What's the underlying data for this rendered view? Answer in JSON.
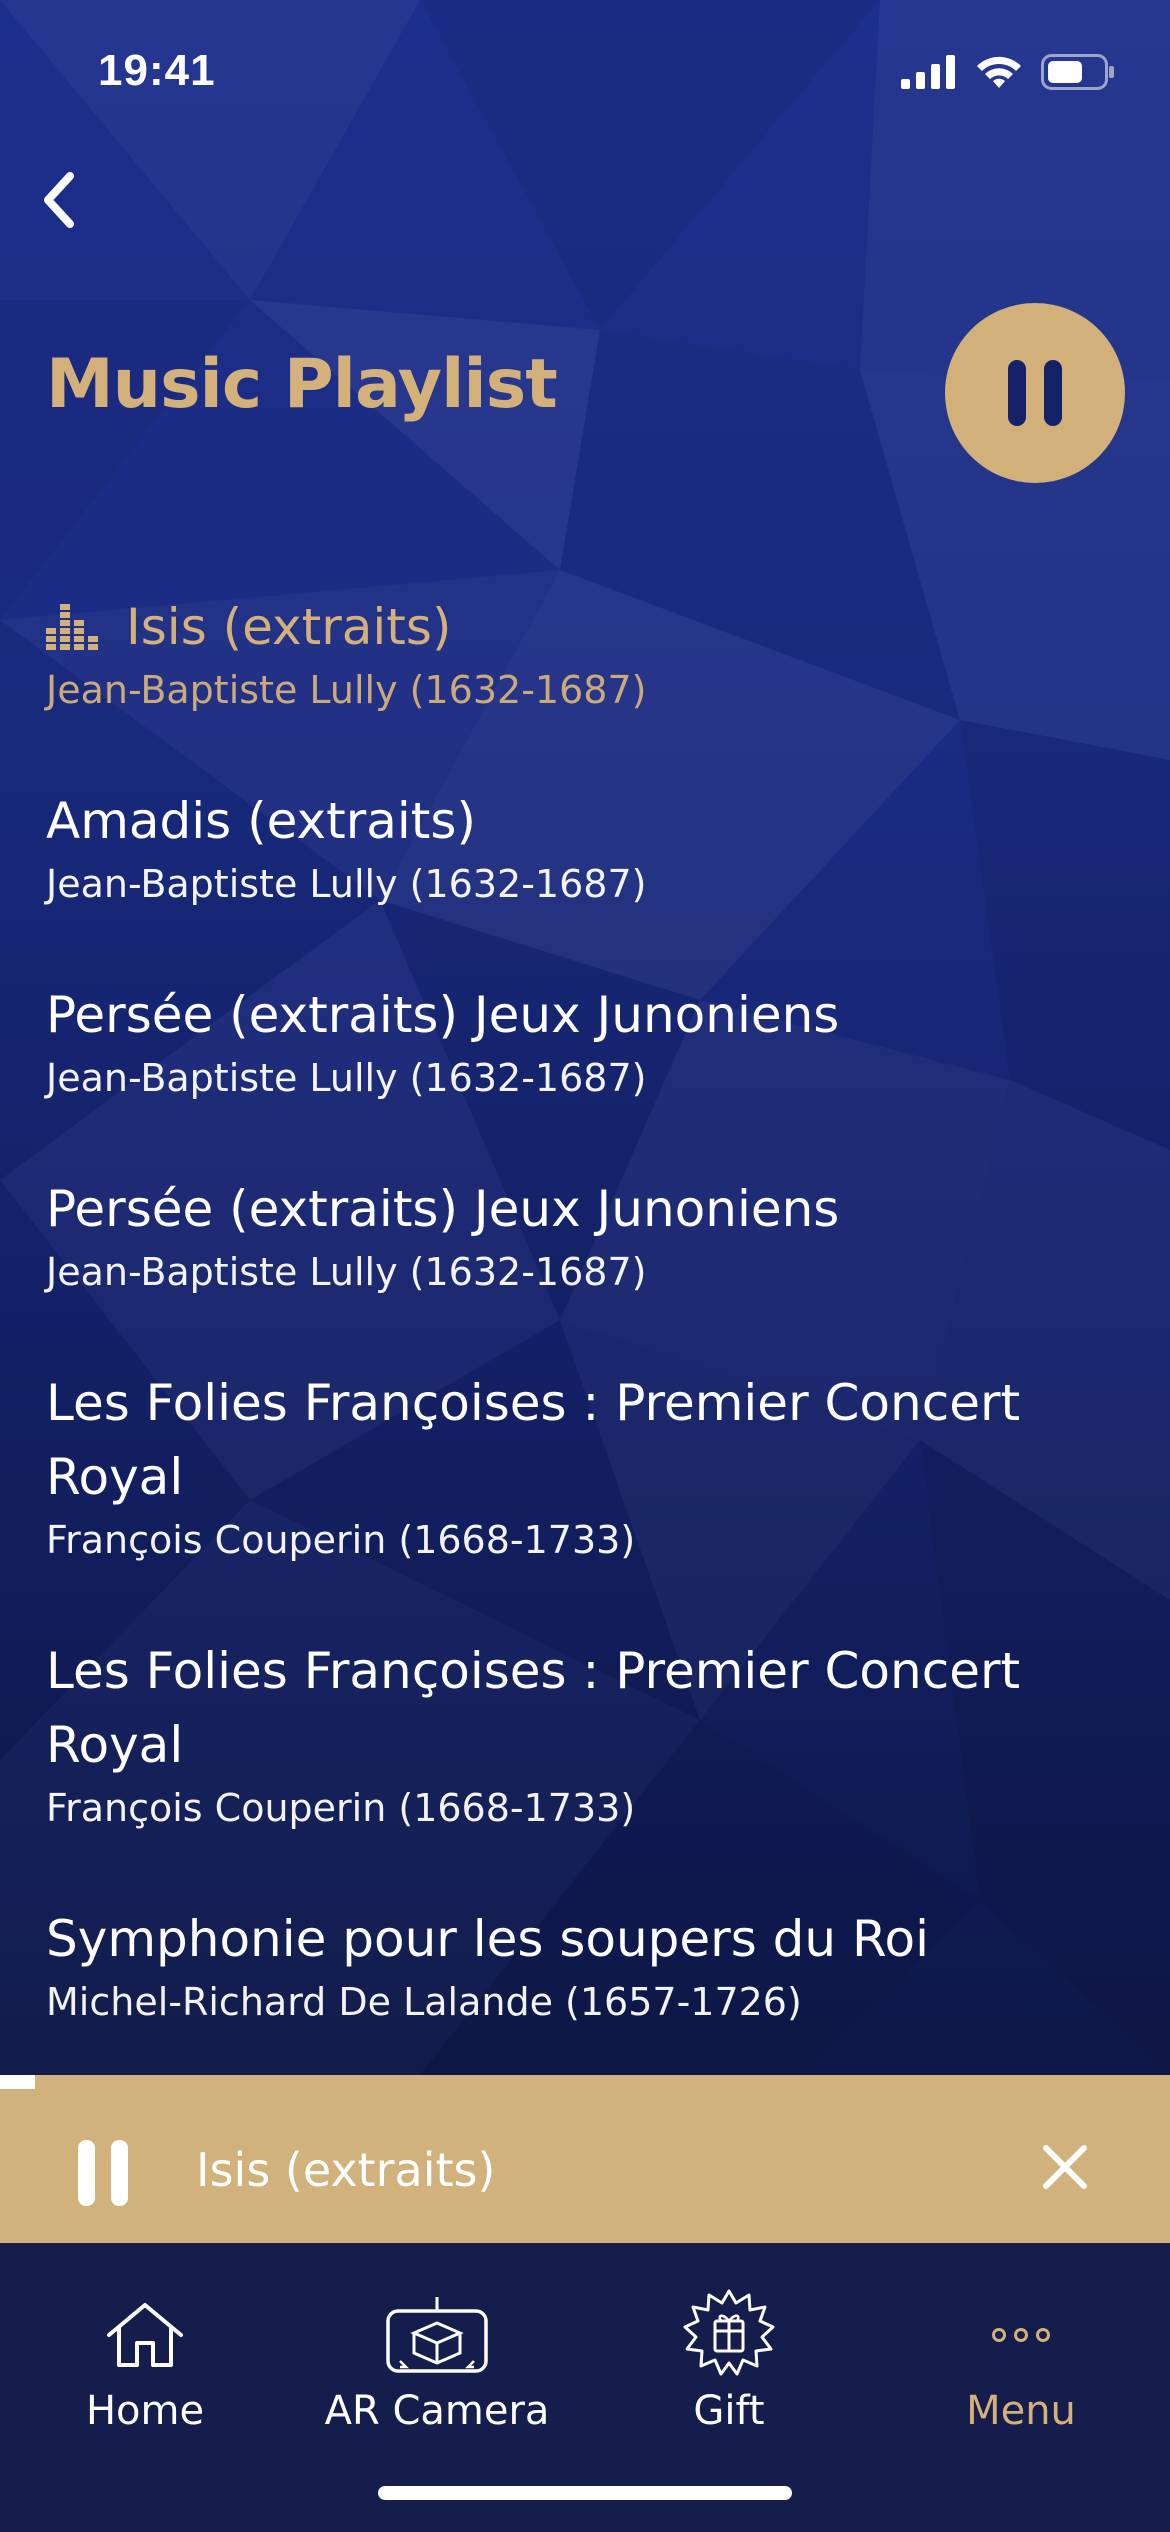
{
  "status_bar": {
    "time": "19:41"
  },
  "header": {
    "title": "Music Playlist"
  },
  "playlist": [
    {
      "title": "Isis (extraits)",
      "artist": "Jean-Baptiste Lully (1632-1687)",
      "active": true
    },
    {
      "title": "Amadis (extraits)",
      "artist": "Jean-Baptiste Lully (1632-1687)",
      "active": false
    },
    {
      "title": "Persée (extraits) Jeux Junoniens",
      "artist": "Jean-Baptiste Lully (1632-1687)",
      "active": false
    },
    {
      "title": "Persée (extraits) Jeux Junoniens",
      "artist": "Jean-Baptiste Lully (1632-1687)",
      "active": false
    },
    {
      "title": "Les Folies Françoises : Premier Concert Royal",
      "artist": "François Couperin (1668-1733)",
      "active": false
    },
    {
      "title": "Les Folies Françoises : Premier Concert Royal",
      "artist": "François Couperin (1668-1733)",
      "active": false
    },
    {
      "title": "Symphonie pour les soupers du Roi",
      "artist": "Michel-Richard De Lalande (1657-1726)",
      "active": false
    }
  ],
  "mini_player": {
    "title": "Isis (extraits)",
    "progress_percent": 3
  },
  "tabs": [
    {
      "label": "Home",
      "icon": "home-icon",
      "active": false
    },
    {
      "label": "AR Camera",
      "icon": "ar-camera-icon",
      "active": false
    },
    {
      "label": "Gift",
      "icon": "gift-icon",
      "active": false
    },
    {
      "label": "Menu",
      "icon": "more-icon",
      "active": true
    }
  ],
  "colors": {
    "accent_gold": "#d4b07a",
    "background_blue": "#1b2b82",
    "tab_bar": "#151d4d"
  }
}
